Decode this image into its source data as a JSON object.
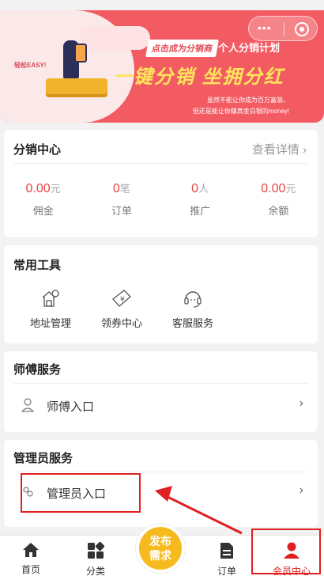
{
  "banner": {
    "cta": "点击成为分销商",
    "plan_title": "个人分销计划",
    "slogan": "一键分销 坐拥分红",
    "sub1": "虽然不能让你成为百万富翁，",
    "sub2": "但还是能让你赚真金白银的money!",
    "easy": "轻松EASY!"
  },
  "distribution": {
    "title": "分销中心",
    "more": "查看详情 ›",
    "stats": [
      {
        "value": "0.00",
        "unit": "元",
        "label": "佣金"
      },
      {
        "value": "0",
        "unit": "笔",
        "label": "订单"
      },
      {
        "value": "0",
        "unit": "人",
        "label": "推广"
      },
      {
        "value": "0.00",
        "unit": "元",
        "label": "余额"
      }
    ]
  },
  "tools": {
    "title": "常用工具",
    "items": [
      {
        "label": "地址管理",
        "icon": "home-location-icon"
      },
      {
        "label": "领券中心",
        "icon": "coupon-icon"
      },
      {
        "label": "客服服务",
        "icon": "headset-icon"
      }
    ]
  },
  "master": {
    "title": "师傅服务",
    "entry": "师傅入口"
  },
  "admin": {
    "title": "管理员服务",
    "entry": "管理员入口"
  },
  "tabbar": {
    "items": [
      {
        "label": "首页",
        "icon": "home-icon"
      },
      {
        "label": "分类",
        "icon": "category-icon"
      },
      {
        "label": "订单",
        "icon": "order-icon"
      },
      {
        "label": "会员中心",
        "icon": "user-icon"
      }
    ],
    "publish_line1": "发布",
    "publish_line2": "需求"
  },
  "colors": {
    "accent": "#e02020",
    "banner": "#f25b62",
    "publish": "#f7ba1e"
  }
}
